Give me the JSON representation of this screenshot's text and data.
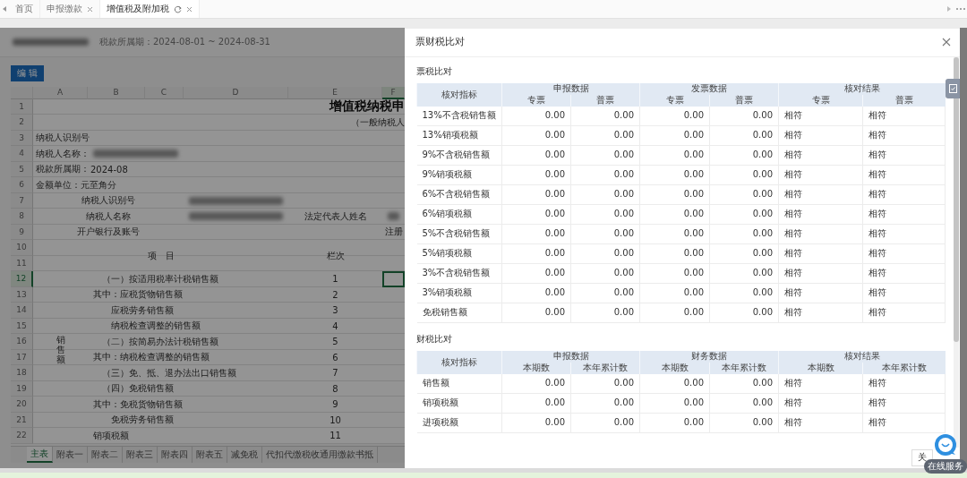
{
  "tab_bar": {
    "tabs": [
      {
        "label": "首页",
        "closable": false,
        "refreshable": false,
        "selected": false
      },
      {
        "label": "申报缴款",
        "closable": true,
        "refreshable": false,
        "selected": false
      },
      {
        "label": "增值税及附加税",
        "closable": true,
        "refreshable": true,
        "selected": true
      }
    ]
  },
  "declaration_page": {
    "period": "税款所属期：2024-08-01 ~ 2024-08-31",
    "edit_button": "编 辑",
    "columns": [
      {
        "label": "A",
        "selected": false
      },
      {
        "label": "B",
        "selected": false
      },
      {
        "label": "C",
        "selected": false
      },
      {
        "label": "D",
        "selected": false
      },
      {
        "label": "E",
        "selected": false
      },
      {
        "label": "F",
        "selected": true
      }
    ],
    "group_label": "销售额",
    "rows": [
      {
        "num": "1",
        "selected": false,
        "kind": "title",
        "text": "增值税纳税申"
      },
      {
        "num": "2",
        "selected": false,
        "kind": "subtitle",
        "text": "（一般纳税人"
      },
      {
        "num": "3",
        "selected": false,
        "kind": "info",
        "label": "纳税人识别号",
        "blurred": false
      },
      {
        "num": "4",
        "selected": false,
        "kind": "info",
        "label": "纳税人名称：",
        "blurred": true
      },
      {
        "num": "5",
        "selected": false,
        "kind": "info",
        "label": "税款所属期：",
        "value": "2024-08",
        "blurred": false
      },
      {
        "num": "6",
        "selected": false,
        "kind": "info",
        "label": "金额单位：元至角分",
        "blurred": false
      },
      {
        "num": "7",
        "selected": false,
        "kind": "field",
        "label": "纳税人识别号",
        "blurred": true,
        "right_blurred": false
      },
      {
        "num": "8",
        "selected": false,
        "kind": "field",
        "label": "纳税人名称",
        "blurred": true,
        "label2": "法定代表人姓名",
        "right_blurred": true
      },
      {
        "num": "9",
        "selected": false,
        "kind": "field",
        "label": "开户银行及账号",
        "blurred": false,
        "right_label": "注册",
        "right_blurred": false
      },
      {
        "num": "10",
        "selected": false,
        "kind": "header",
        "item_header": "项　目",
        "number_header": "栏次"
      },
      {
        "num": "11",
        "selected": false,
        "kind": "continued"
      },
      {
        "num": "12",
        "selected": true,
        "kind": "category",
        "text": "（一）按适用税率计税销售额",
        "line": "1"
      },
      {
        "num": "13",
        "selected": false,
        "kind": "of-which",
        "text": "其中：应税货物销售额",
        "line": "2"
      },
      {
        "num": "14",
        "selected": false,
        "kind": "detail",
        "text": "应税劳务销售额",
        "line": "3"
      },
      {
        "num": "15",
        "selected": false,
        "kind": "detail",
        "text": "纳税检查调整的销售额",
        "line": "4"
      },
      {
        "num": "16",
        "selected": false,
        "kind": "category",
        "text": "（二）按简易办法计税销售额",
        "line": "5"
      },
      {
        "num": "17",
        "selected": false,
        "kind": "of-which",
        "text": "其中：纳税检查调整的销售额",
        "line": "6"
      },
      {
        "num": "18",
        "selected": false,
        "kind": "category",
        "text": "（三）免、抵、退办法出口销售额",
        "line": "7"
      },
      {
        "num": "19",
        "selected": false,
        "kind": "category",
        "text": "（四）免税销售额",
        "line": "8"
      },
      {
        "num": "20",
        "selected": false,
        "kind": "of-which",
        "text": "其中：免税货物销售额",
        "line": "9"
      },
      {
        "num": "21",
        "selected": false,
        "kind": "detail",
        "text": "免税劳务销售额",
        "line": "10"
      },
      {
        "num": "22",
        "selected": false,
        "kind": "standalone",
        "text": "销项税额",
        "line": "11"
      }
    ],
    "sheet_tabs": [
      {
        "label": "主表",
        "selected": true
      },
      {
        "label": "附表一",
        "selected": false
      },
      {
        "label": "附表二",
        "selected": false
      },
      {
        "label": "附表三",
        "selected": false
      },
      {
        "label": "附表四",
        "selected": false
      },
      {
        "label": "附表五",
        "selected": false
      },
      {
        "label": "减免税",
        "selected": false
      },
      {
        "label": "代扣代缴税收通用缴款书抵",
        "selected": false
      }
    ]
  },
  "dialog": {
    "title": "票财税比对",
    "close_button": "关",
    "sections": [
      {
        "title": "票税比对",
        "index_header": "核对指标",
        "groups": [
          "申报数据",
          "发票数据",
          "核对结果"
        ],
        "sub_headers": [
          "专票",
          "普票",
          "专票",
          "普票",
          "专票",
          "普票"
        ],
        "rows": [
          {
            "label": "13%不含税销售额",
            "values": [
              "0.00",
              "0.00",
              "0.00",
              "0.00"
            ],
            "results": [
              "相符",
              "相符"
            ]
          },
          {
            "label": "13%销项税额",
            "values": [
              "0.00",
              "0.00",
              "0.00",
              "0.00"
            ],
            "results": [
              "相符",
              "相符"
            ]
          },
          {
            "label": "9%不含税销售额",
            "values": [
              "0.00",
              "0.00",
              "0.00",
              "0.00"
            ],
            "results": [
              "相符",
              "相符"
            ]
          },
          {
            "label": "9%销项税额",
            "values": [
              "0.00",
              "0.00",
              "0.00",
              "0.00"
            ],
            "results": [
              "相符",
              "相符"
            ]
          },
          {
            "label": "6%不含税销售额",
            "values": [
              "0.00",
              "0.00",
              "0.00",
              "0.00"
            ],
            "results": [
              "相符",
              "相符"
            ]
          },
          {
            "label": "6%销项税额",
            "values": [
              "0.00",
              "0.00",
              "0.00",
              "0.00"
            ],
            "results": [
              "相符",
              "相符"
            ]
          },
          {
            "label": "5%不含税销售额",
            "values": [
              "0.00",
              "0.00",
              "0.00",
              "0.00"
            ],
            "results": [
              "相符",
              "相符"
            ]
          },
          {
            "label": "5%销项税额",
            "values": [
              "0.00",
              "0.00",
              "0.00",
              "0.00"
            ],
            "results": [
              "相符",
              "相符"
            ]
          },
          {
            "label": "3%不含税销售额",
            "values": [
              "0.00",
              "0.00",
              "0.00",
              "0.00"
            ],
            "results": [
              "相符",
              "相符"
            ]
          },
          {
            "label": "3%销项税额",
            "values": [
              "0.00",
              "0.00",
              "0.00",
              "0.00"
            ],
            "results": [
              "相符",
              "相符"
            ]
          },
          {
            "label": "免税销售额",
            "values": [
              "0.00",
              "0.00",
              "0.00",
              "0.00"
            ],
            "results": [
              "相符",
              "相符"
            ]
          }
        ]
      },
      {
        "title": "财税比对",
        "index_header": "核对指标",
        "groups": [
          "申报数据",
          "财务数据",
          "核对结果"
        ],
        "sub_headers": [
          "本期数",
          "本年累计数",
          "本期数",
          "本年累计数",
          "本期数",
          "本年累计数"
        ],
        "rows": [
          {
            "label": "销售额",
            "values": [
              "0.00",
              "0.00",
              "0.00",
              "0.00"
            ],
            "results": [
              "相符",
              "相符"
            ]
          },
          {
            "label": "销项税额",
            "values": [
              "0.00",
              "0.00",
              "0.00",
              "0.00"
            ],
            "results": [
              "相符",
              "相符"
            ]
          },
          {
            "label": "进项税额",
            "values": [
              "0.00",
              "0.00",
              "0.00",
              "0.00"
            ],
            "results": [
              "相符",
              "相符"
            ]
          }
        ]
      }
    ]
  },
  "chat_widget": {
    "label": "在线服务"
  }
}
